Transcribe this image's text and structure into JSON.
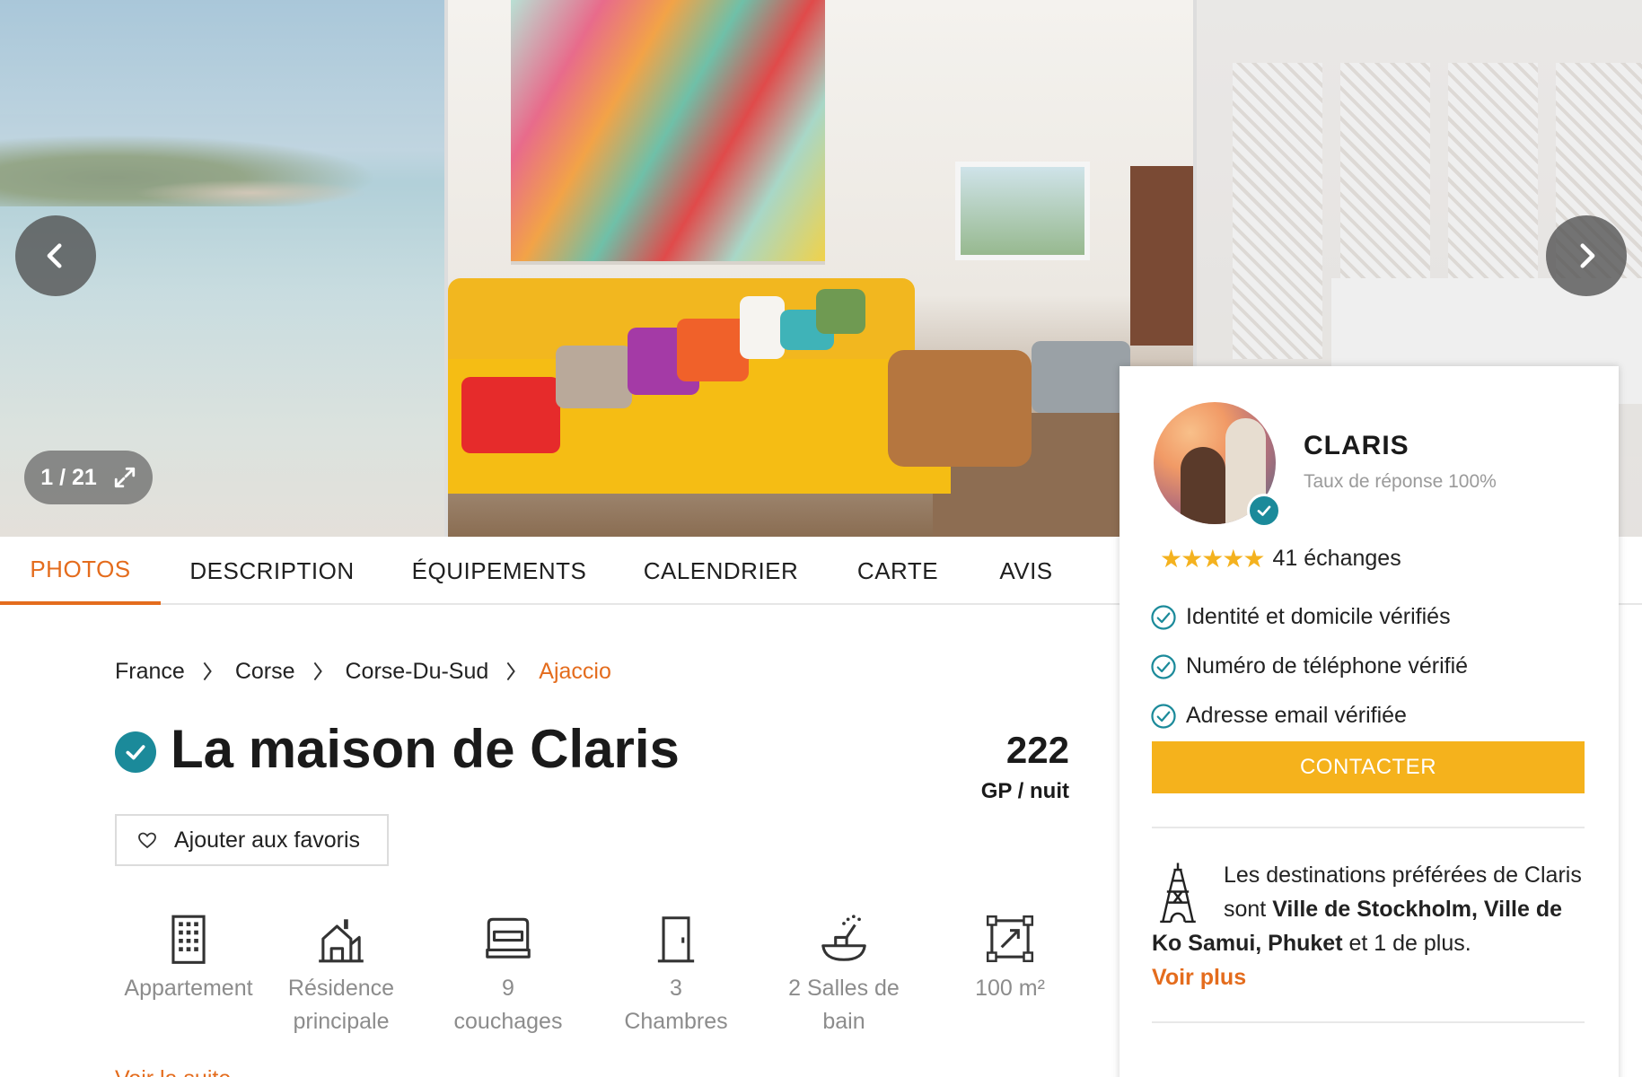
{
  "gallery": {
    "counter": "1 / 21",
    "photos": [
      "beach-photo",
      "living-room-photo",
      "bedroom-photo"
    ]
  },
  "tabs": [
    {
      "label": "PHOTOS",
      "active": true
    },
    {
      "label": "DESCRIPTION",
      "active": false
    },
    {
      "label": "ÉQUIPEMENTS",
      "active": false
    },
    {
      "label": "CALENDRIER",
      "active": false
    },
    {
      "label": "CARTE",
      "active": false
    },
    {
      "label": "AVIS",
      "active": false
    }
  ],
  "breadcrumb": [
    "France",
    "Corse",
    "Corse-Du-Sud",
    "Ajaccio"
  ],
  "listing": {
    "title": "La maison de Claris",
    "price": "222",
    "price_unit": "GP / nuit",
    "favorite_label": "Ajouter aux favoris",
    "features": [
      {
        "icon": "building-icon",
        "line1": "Appartement",
        "line2": ""
      },
      {
        "icon": "house-icon",
        "line1": "Résidence",
        "line2": "principale"
      },
      {
        "icon": "bed-icon",
        "line1": "9",
        "line2": "couchages"
      },
      {
        "icon": "door-icon",
        "line1": "3",
        "line2": "Chambres"
      },
      {
        "icon": "shower-icon",
        "line1": "2 Salles de",
        "line2": "bain"
      },
      {
        "icon": "area-icon",
        "line1": "100 m²",
        "line2": ""
      }
    ],
    "more_link": "Voir la suite"
  },
  "host": {
    "name": "CLARIS",
    "response_rate": "Taux de réponse 100%",
    "rating": 5,
    "stars": "★★★★★",
    "exchanges": "41 échanges",
    "verifications": [
      "Identité et domicile vérifiés",
      "Numéro de téléphone vérifié",
      "Adresse email vérifiée"
    ],
    "contact_label": "CONTACTER",
    "destinations": {
      "intro": "Les destinations préférées de Claris sont ",
      "places": "Ville de Stockholm, Ville de Ko Samui, Phuket",
      "outro": " et 1 de plus.",
      "see_more": "Voir plus"
    }
  },
  "colors": {
    "accent": "#e46c1d",
    "teal": "#1b8a9a",
    "button": "#f5b21c",
    "stars": "#f4b21f"
  }
}
